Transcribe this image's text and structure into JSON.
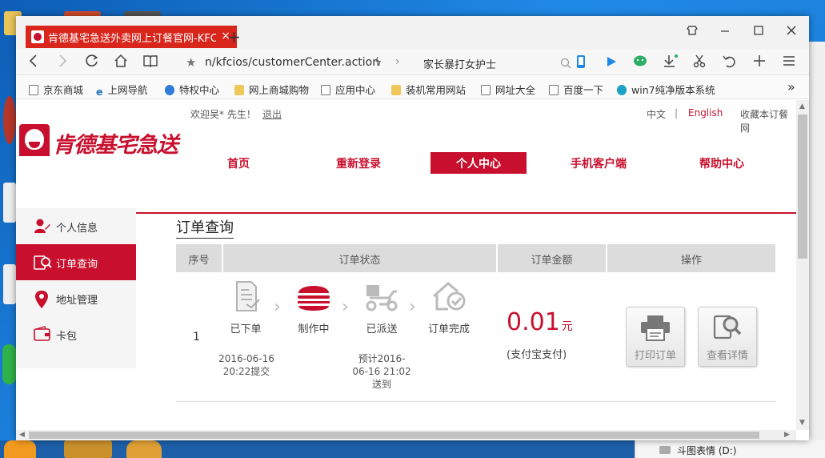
{
  "browser": {
    "tab_title": "肯德基宅急送外卖网上订餐官网-KFC",
    "tab_close": "×",
    "new_tab": "+",
    "address": "n/kfcios/customerCenter.action",
    "search_text": "家长暴打女护士"
  },
  "bookmarks": [
    "京东商城",
    "上网导航",
    "特权中心",
    "网上商城购物",
    "应用中心",
    "装机常用网站",
    "网址大全",
    "百度一下",
    "win7纯净版本系统"
  ],
  "bookmarks_more": "»",
  "taskbar": {
    "drive_label": "斗图表情 (D:)"
  },
  "site": {
    "welcome": "欢迎吴* 先生！",
    "logout": "退出",
    "lang_cn": "中文",
    "lang_sep": "|",
    "lang_en": "English",
    "favorite": "收藏本订餐网",
    "logo_text": "肯德基宅急送",
    "nav": [
      "首页",
      "重新登录",
      "个人中心",
      "手机客户端",
      "帮助中心"
    ],
    "nav_active": "个人中心",
    "accent_color": "#c8102e"
  },
  "sidebar": {
    "items": [
      "个人信息",
      "订单查询",
      "地址管理",
      "卡包"
    ],
    "active": "订单查询"
  },
  "orders": {
    "title": "订单查询",
    "headers": [
      "序号",
      "订单状态",
      "订单金额",
      "操作"
    ],
    "row": {
      "index": "1",
      "steps": [
        "已下单",
        "制作中",
        "已派送",
        "订单完成"
      ],
      "placed_time_1": "2016-06-16",
      "placed_time_2": "20:22提交",
      "eta_1": "预计2016-",
      "eta_2": "06-16 21:02",
      "eta_3": "送到",
      "amount": "0.01",
      "amount_unit": "元",
      "pay_method": "(支付宝支付)",
      "print_button": "打印订单",
      "detail_button": "查看详情"
    }
  }
}
